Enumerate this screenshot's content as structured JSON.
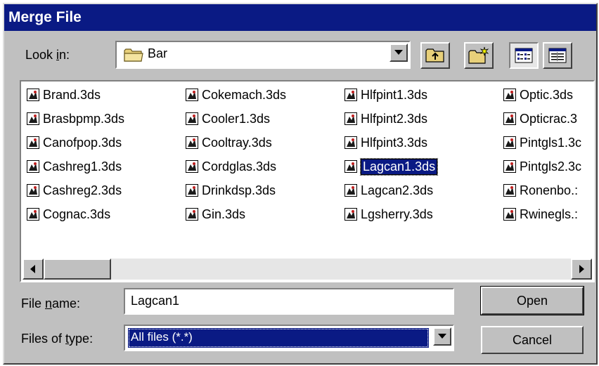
{
  "window": {
    "title": "Merge File"
  },
  "look_in": {
    "label_pre": "Look ",
    "label_hot": "i",
    "label_post": "n:",
    "value": "Bar",
    "icon": "folder-icon"
  },
  "toolbar": {
    "buttons": [
      {
        "name": "up-one-level-button",
        "icon": "up-folder-icon"
      },
      {
        "name": "create-new-folder-button",
        "icon": "new-folder-icon"
      },
      {
        "name": "list-view-button",
        "icon": "list-view-icon"
      },
      {
        "name": "details-view-button",
        "icon": "details-view-icon"
      }
    ]
  },
  "files": {
    "columns": [
      [
        "Brand.3ds",
        "Brasbpmp.3ds",
        "Canofpop.3ds",
        "Cashreg1.3ds",
        "Cashreg2.3ds",
        "Cognac.3ds"
      ],
      [
        "Cokemach.3ds",
        "Cooler1.3ds",
        "Cooltray.3ds",
        "Cordglas.3ds",
        "Drinkdsp.3ds",
        "Gin.3ds"
      ],
      [
        "Hlfpint1.3ds",
        "Hlfpint2.3ds",
        "Hlfpint3.3ds",
        "Lagcan1.3ds",
        "Lagcan2.3ds",
        "Lgsherry.3ds"
      ],
      [
        "Optic.3ds",
        "Opticrac.3",
        "Pintgls1.3c",
        "Pintgls2.3c",
        "Ronenbo.:",
        "Rwinegls.:"
      ]
    ],
    "selected": "Lagcan1.3ds",
    "icon": "3ds-file-icon"
  },
  "file_name": {
    "label_pre": "File ",
    "label_hot": "n",
    "label_post": "ame:",
    "value": "Lagcan1"
  },
  "file_type": {
    "label_pre": "Files of ",
    "label_hot": "t",
    "label_post": "ype:",
    "value": "All files (*.*)"
  },
  "buttons": {
    "open_hot": "O",
    "open_rest": "pen",
    "cancel": "Cancel"
  },
  "colors": {
    "titlebar": "#0a1a84",
    "face": "#c0c0c0",
    "selection": "#0a1a84"
  }
}
